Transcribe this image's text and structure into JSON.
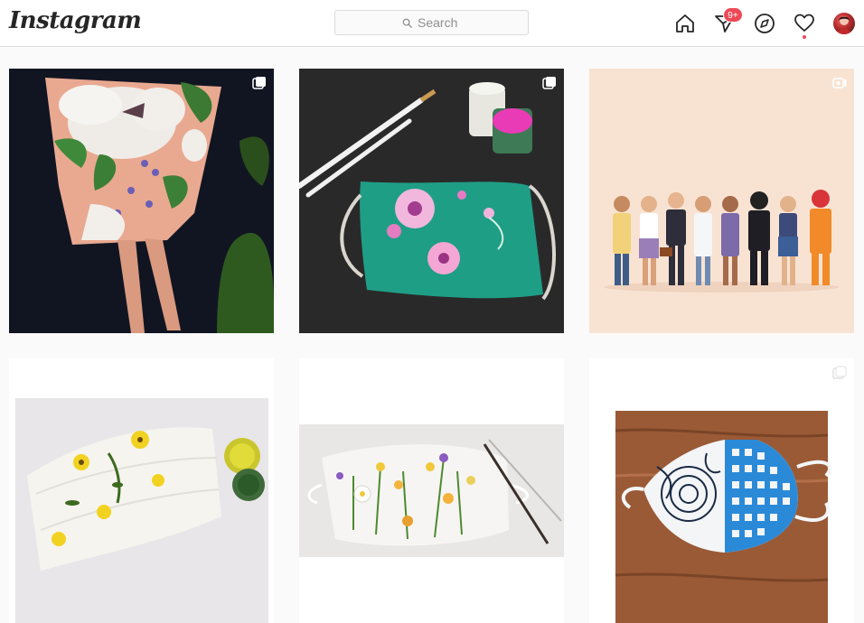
{
  "header": {
    "logo_text": "Instagram",
    "search_placeholder": "Search",
    "notification_badge": "9+"
  },
  "icons": {
    "home": "home-icon",
    "direct": "paper-plane-icon",
    "explore": "compass-icon",
    "activity": "heart-icon",
    "profile": "avatar"
  },
  "colors": {
    "badge": "#ed4956",
    "text": "#262626",
    "border": "#dbdbdb"
  },
  "grid": {
    "posts": [
      {
        "type": "carousel"
      },
      {
        "type": "carousel"
      },
      {
        "type": "video"
      },
      {
        "type": "image"
      },
      {
        "type": "carousel"
      },
      {
        "type": "carousel"
      }
    ]
  }
}
